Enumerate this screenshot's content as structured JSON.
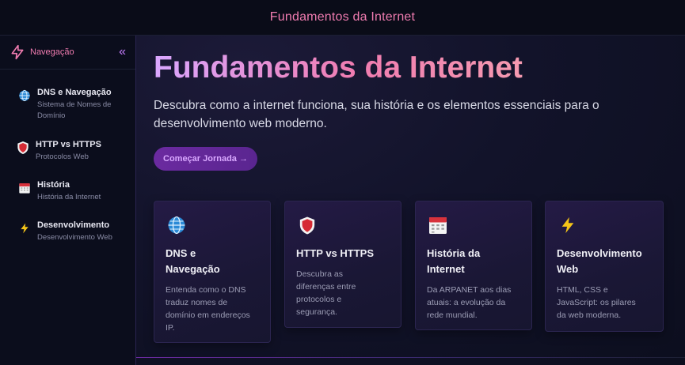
{
  "topbar": {
    "title": "Fundamentos da Internet"
  },
  "sidebar": {
    "title": "Navegação",
    "collapse_glyph": "«",
    "items": [
      {
        "icon": "globe-icon",
        "title": "DNS e Navegação",
        "subtitle": "Sistema de Nomes de Domínio"
      },
      {
        "icon": "shield-icon",
        "title": "HTTP vs HTTPS",
        "subtitle": "Protocolos Web"
      },
      {
        "icon": "calendar-icon",
        "title": "História",
        "subtitle": "História da Internet"
      },
      {
        "icon": "lightning-icon",
        "title": "Desenvolvimento",
        "subtitle": "Desenvolvimento Web"
      }
    ]
  },
  "hero": {
    "title": "Fundamentos da Internet",
    "description": "Descubra como a internet funciona, sua história e os elementos essenciais para o desenvolvimento web moderno.",
    "cta_label": "Começar Jornada →"
  },
  "cards": [
    {
      "icon": "globe-icon",
      "title": "DNS e Navegação",
      "description": "Entenda como o DNS traduz nomes de domínio em endereços IP."
    },
    {
      "icon": "shield-icon",
      "title": "HTTP vs HTTPS",
      "description": "Descubra as diferenças entre protocolos e segurança."
    },
    {
      "icon": "calendar-icon",
      "title": "História da Internet",
      "description": "Da ARPANET aos dias atuais: a evolução da rede mundial."
    },
    {
      "icon": "lightning-icon",
      "title": "Desenvolvimento Web",
      "description": "HTML, CSS e JavaScript: os pilares da web moderna."
    }
  ],
  "colors": {
    "accent_pink": "#f07cb0",
    "accent_purple": "#c77dff",
    "background": "#0b0d1a"
  }
}
